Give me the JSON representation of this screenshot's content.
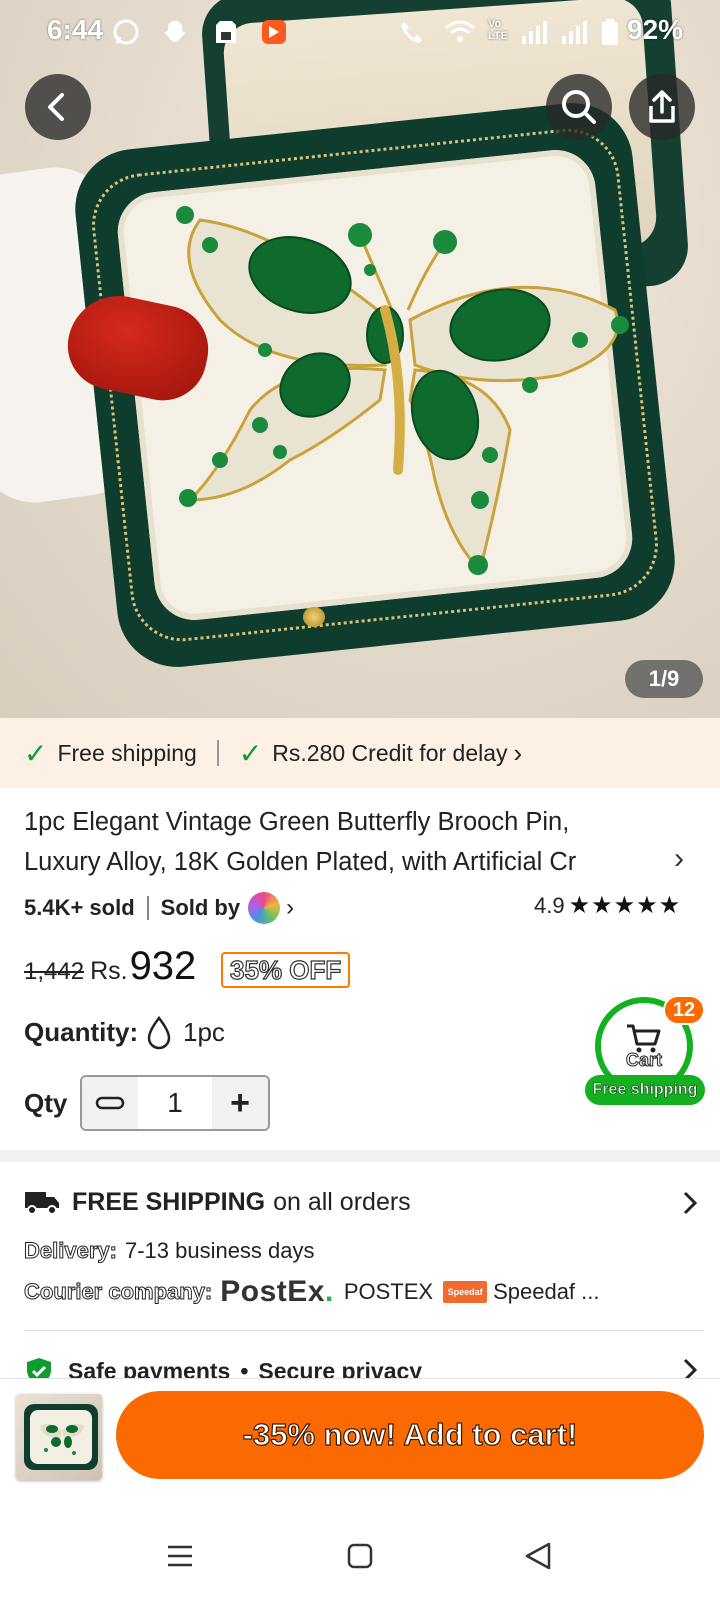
{
  "status_bar": {
    "time": "6:44",
    "battery": "92%",
    "icons": [
      "whatsapp-icon",
      "snapchat-icon",
      "sim-card-icon",
      "app-icon",
      "wifi-call-icon",
      "wifi-icon",
      "volte-icon",
      "signal-icon",
      "signal-icon",
      "battery-icon"
    ],
    "volte_label": "Vo LTE"
  },
  "hero": {
    "counter": "1/9",
    "icons": {
      "back": "back-arrow-icon",
      "search": "search-icon",
      "share": "share-icon"
    }
  },
  "benefits": {
    "free_shipping": "Free shipping",
    "credit": "Rs.280 Credit for delay",
    "credit_arrow": "›"
  },
  "product": {
    "title_line1": "1pc Elegant Vintage Green Butterfly Brooch Pin,",
    "title_line2": "Luxury Alloy, 18K Golden Plated, with Artificial Cr",
    "title_chevron": "›",
    "sold": "5.4K+ sold",
    "sold_by": "Sold by",
    "sold_by_chevron": "›",
    "rating": "4.9",
    "stars": "★★★★★",
    "old_price": "1,442",
    "currency": "Rs.",
    "price": "932",
    "discount": "35% OFF",
    "quantity_label": "Quantity:",
    "quantity_value": "1pc",
    "qty_label": "Qty",
    "qty_value": "1",
    "qty_minus": "−",
    "qty_plus": "+"
  },
  "cart_float": {
    "badge": "12",
    "label": "Cart",
    "free_shipping": "Free shipping"
  },
  "shipping": {
    "headline_strong": "FREE SHIPPING",
    "headline_rest": "on all orders",
    "delivery_label": "Delivery:",
    "delivery_value": "7-13 business days",
    "courier_label": "Courier company:",
    "postex_logo": "PostEx",
    "postex_logo_dot": ".",
    "postex_name": "POSTEX",
    "speedaf_logo": "Speedaf",
    "speedaf_name": "Speedaf ..."
  },
  "safety": {
    "payments": "Safe payments",
    "bullet": "•",
    "privacy": "Secure privacy"
  },
  "bottom_bar": {
    "add_to_cart": "-35% now! Add to cart!"
  },
  "colors": {
    "accent": "#fa6a00",
    "green": "#13b01f",
    "check": "#0f9b2f",
    "benefit_bg": "#fdf1e6"
  }
}
